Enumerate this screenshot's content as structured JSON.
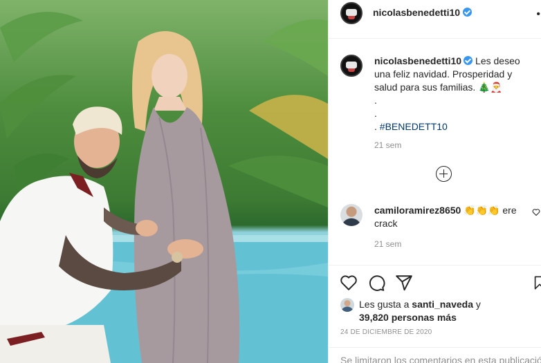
{
  "post": {
    "username": "nicolasbenedetti10",
    "more_icon": "•"
  },
  "caption": {
    "username": "nicolasbenedetti10",
    "text": "Les deseo una feliz navidad. Prosperidad y salud para sus familias. 🎄🎅",
    "lines": [
      ".",
      ".",
      "."
    ],
    "hashtag": "#BENEDETT10",
    "time": "21 sem"
  },
  "comment": {
    "username": "camiloramirez8650",
    "text": "👏👏👏 ere crack",
    "time": "21 sem"
  },
  "likes": {
    "prefix": "Les gusta a",
    "liker": "santi_naveda",
    "conjunction": "y",
    "count": "39,820 personas más"
  },
  "date": "24 DE DICIEMBRE DE 2020",
  "comments_limited": "Se limitaron los comentarios en esta publicación.",
  "icons": {
    "verified": "verified-badge-icon",
    "heart": "heart-icon",
    "comment": "comment-icon",
    "share": "share-icon",
    "save": "bookmark-icon",
    "load_more": "plus-circle-icon"
  },
  "colors": {
    "verified": "#3897f0",
    "hashtag": "#00376b",
    "meta": "#8e8e8e",
    "text": "#262626"
  }
}
